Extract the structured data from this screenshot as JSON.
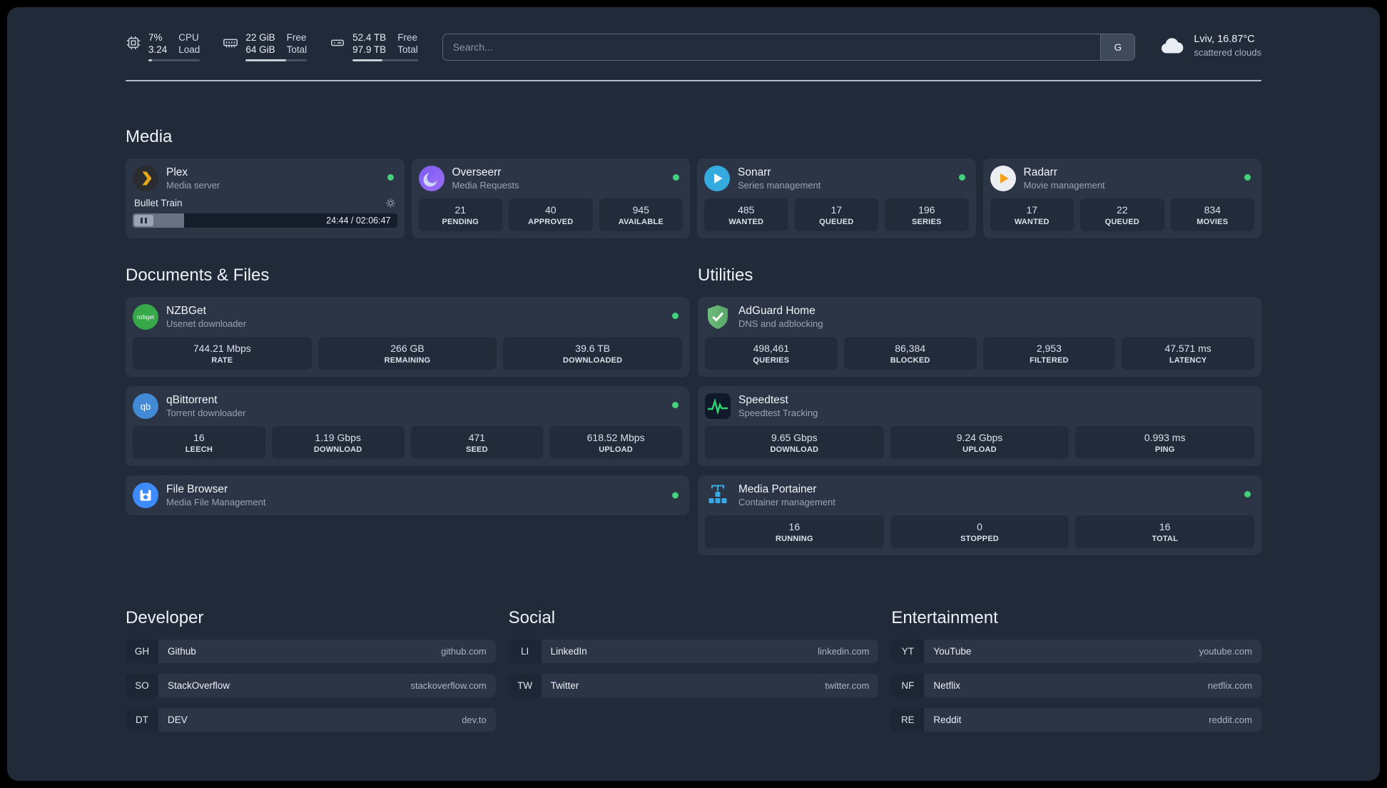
{
  "topbar": {
    "resources": [
      {
        "name": "cpu",
        "v1": "7%",
        "v2": "3.24",
        "l1": "CPU",
        "l2": "Load",
        "percent": 7
      },
      {
        "name": "memory",
        "v1": "22 GiB",
        "v2": "64 GiB",
        "l1": "Free",
        "l2": "Total",
        "percent": 66
      },
      {
        "name": "disk",
        "v1": "52.4 TB",
        "v2": "97.9 TB",
        "l1": "Free",
        "l2": "Total",
        "percent": 46
      }
    ],
    "search": {
      "placeholder": "Search...",
      "button": "G"
    },
    "weather": {
      "location": "Lviv, 16.87°C",
      "condition": "scattered clouds"
    }
  },
  "media": {
    "title": "Media",
    "plex": {
      "title": "Plex",
      "subtitle": "Media server",
      "now_playing": "Bullet Train",
      "time": "24:44 / 02:06:47",
      "progress_percent": 19.5
    },
    "overseerr": {
      "title": "Overseerr",
      "subtitle": "Media Requests",
      "stats": [
        {
          "value": "21",
          "label": "PENDING"
        },
        {
          "value": "40",
          "label": "APPROVED"
        },
        {
          "value": "945",
          "label": "AVAILABLE"
        }
      ]
    },
    "sonarr": {
      "title": "Sonarr",
      "subtitle": "Series management",
      "stats": [
        {
          "value": "485",
          "label": "WANTED"
        },
        {
          "value": "17",
          "label": "QUEUED"
        },
        {
          "value": "196",
          "label": "SERIES"
        }
      ]
    },
    "radarr": {
      "title": "Radarr",
      "subtitle": "Movie management",
      "stats": [
        {
          "value": "17",
          "label": "WANTED"
        },
        {
          "value": "22",
          "label": "QUEUED"
        },
        {
          "value": "834",
          "label": "MOVIES"
        }
      ]
    }
  },
  "documents": {
    "title": "Documents & Files",
    "nzbget": {
      "title": "NZBGet",
      "subtitle": "Usenet downloader",
      "stats": [
        {
          "value": "744.21 Mbps",
          "label": "RATE"
        },
        {
          "value": "266 GB",
          "label": "REMAINING"
        },
        {
          "value": "39.6 TB",
          "label": "DOWNLOADED"
        }
      ]
    },
    "qbittorrent": {
      "title": "qBittorrent",
      "subtitle": "Torrent downloader",
      "stats": [
        {
          "value": "16",
          "label": "LEECH"
        },
        {
          "value": "1.19 Gbps",
          "label": "DOWNLOAD"
        },
        {
          "value": "471",
          "label": "SEED"
        },
        {
          "value": "618.52 Mbps",
          "label": "UPLOAD"
        }
      ]
    },
    "filebrowser": {
      "title": "File Browser",
      "subtitle": "Media File Management"
    }
  },
  "utilities": {
    "title": "Utilities",
    "adguard": {
      "title": "AdGuard Home",
      "subtitle": "DNS and adblocking",
      "stats": [
        {
          "value": "498,461",
          "label": "QUERIES"
        },
        {
          "value": "86,384",
          "label": "BLOCKED"
        },
        {
          "value": "2,953",
          "label": "FILTERED"
        },
        {
          "value": "47.571 ms",
          "label": "LATENCY"
        }
      ]
    },
    "speedtest": {
      "title": "Speedtest",
      "subtitle": "Speedtest Tracking",
      "stats": [
        {
          "value": "9.65 Gbps",
          "label": "DOWNLOAD"
        },
        {
          "value": "9.24 Gbps",
          "label": "UPLOAD"
        },
        {
          "value": "0.993 ms",
          "label": "PING"
        }
      ]
    },
    "portainer": {
      "title": "Media Portainer",
      "subtitle": "Container management",
      "stats": [
        {
          "value": "16",
          "label": "RUNNING"
        },
        {
          "value": "0",
          "label": "STOPPED"
        },
        {
          "value": "16",
          "label": "TOTAL"
        }
      ]
    }
  },
  "bookmarks": [
    {
      "title": "Developer",
      "items": [
        {
          "abbr": "GH",
          "label": "Github",
          "url": "github.com"
        },
        {
          "abbr": "SO",
          "label": "StackOverflow",
          "url": "stackoverflow.com"
        },
        {
          "abbr": "DT",
          "label": "DEV",
          "url": "dev.to"
        }
      ]
    },
    {
      "title": "Social",
      "items": [
        {
          "abbr": "LI",
          "label": "LinkedIn",
          "url": "linkedin.com"
        },
        {
          "abbr": "TW",
          "label": "Twitter",
          "url": "twitter.com"
        }
      ]
    },
    {
      "title": "Entertainment",
      "items": [
        {
          "abbr": "YT",
          "label": "YouTube",
          "url": "youtube.com"
        },
        {
          "abbr": "NF",
          "label": "Netflix",
          "url": "netflix.com"
        },
        {
          "abbr": "RE",
          "label": "Reddit",
          "url": "reddit.com"
        }
      ]
    }
  ],
  "colors": {
    "status_online": "#43d17c",
    "accent_blue": "#38a9e4",
    "background": "#212a39",
    "card": "#2b3545"
  }
}
